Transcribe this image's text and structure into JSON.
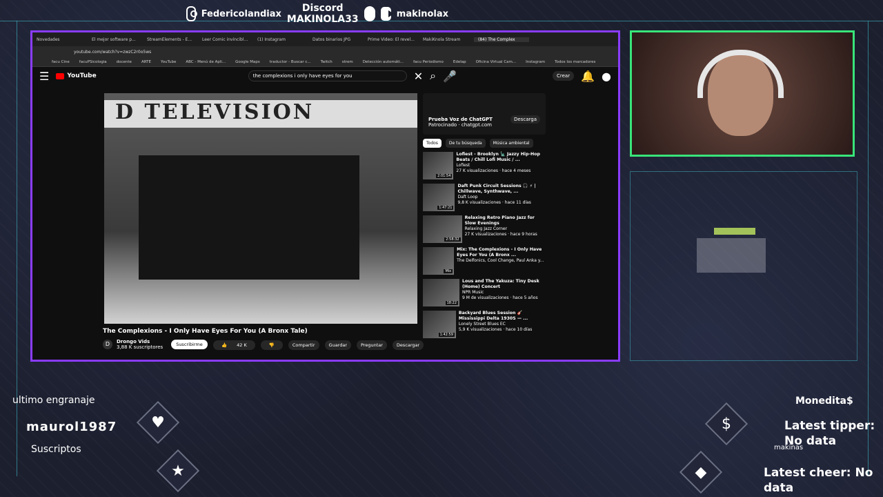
{
  "social": {
    "instagram": "Federicolandiax",
    "discord_label": "Discord",
    "discord_name": "MAKINOLA33",
    "youtube": "makinolax"
  },
  "browser": {
    "tabs": [
      "Novedades",
      "El mejor software p...",
      "StreamElements - E...",
      "Leer Comic invincibl...",
      "(1) Instagram",
      "Datos binarios JPG",
      "Prime Video: El revel...",
      "MakiKnola Stream",
      "(84) The Complex"
    ],
    "url": "youtube.com/watch?v=zwzC2r0o5ws",
    "bookmarks": [
      "facu Cine",
      "facuPSicologia",
      "docente",
      "ARTE",
      "YouTube",
      "ABC - Menú de Apli...",
      "Google Maps",
      "traductor - Buscar c...",
      "Twitch",
      "strem",
      "Detección automáti...",
      "facu Periodismo",
      "Edelap",
      "Oficina Virtual Cam...",
      "Instagram",
      "Todos los marcadores"
    ]
  },
  "youtube": {
    "search": "the complexions i only have eyes for you",
    "create": "Crear",
    "video_sign": "D TELEVISION",
    "title": "The Complexions - I Only Have Eyes For You (A Bronx Tale)",
    "channel": "Drongo Vids",
    "subs": "3,88 K suscriptores",
    "subscribe": "Suscribirme",
    "likes": "42 K",
    "share": "Compartir",
    "save": "Guardar",
    "ask": "Preguntar",
    "download": "Descargar",
    "ad_title": "Prueba Voz de ChatGPT",
    "ad_sub": "Patrocinado · chatgpt.com",
    "ad_btn": "Descarga",
    "chips": [
      "Todos",
      "De tu búsqueda",
      "Música ambiental"
    ],
    "recs": [
      {
        "title": "Lofiest - Brooklyn 🗽 Jazzy Hip-Hop Beats / Chill Lofi Music / ...",
        "channel": "Lofiest",
        "meta": "27 K visualizaciones · hace 4 meses",
        "dur": "2:01:54"
      },
      {
        "title": "Daft Punk Circuit Sessions 🎧 ⚡ | Chillwave, Synthwave, ...",
        "channel": "Daft Loop",
        "meta": "9,8 K visualizaciones · hace 11 días",
        "dur": "1:47:21"
      },
      {
        "title": "Relaxing Retro Piano Jazz for Slow Evenings",
        "channel": "Relaxing Jazz Corner",
        "meta": "27 K visualizaciones · hace 9 horas",
        "dur": "2:58:32"
      },
      {
        "title": "Mix: The Complexions - I Only Have Eyes For You (A Bronx ...",
        "channel": "The Delfonics, Cool Change, Paul Anka y...",
        "meta": "",
        "dur": "Mix"
      },
      {
        "title": "Lous and The Yakuza: Tiny Desk (Home) Concert",
        "channel": "NPR Music",
        "meta": "9 M de visualizaciones · hace 5 años",
        "dur": "18:22"
      },
      {
        "title": "Backyard Blues Session 🎸 Mississippi Delta 1930S — ...",
        "channel": "Lonely Street Blues EC",
        "meta": "5,9 K visualizaciones · hace 10 días",
        "dur": "1:42:59"
      }
    ]
  },
  "overlay": {
    "last_gear_label": "ultimo engranaje",
    "last_gear_user": "maurol1987",
    "subs_label": "Suscriptos",
    "currency_label": "Monedita$",
    "tipper": "Latest tipper: No data",
    "makinas": "makinas",
    "cheer": "Latest cheer: No data"
  }
}
